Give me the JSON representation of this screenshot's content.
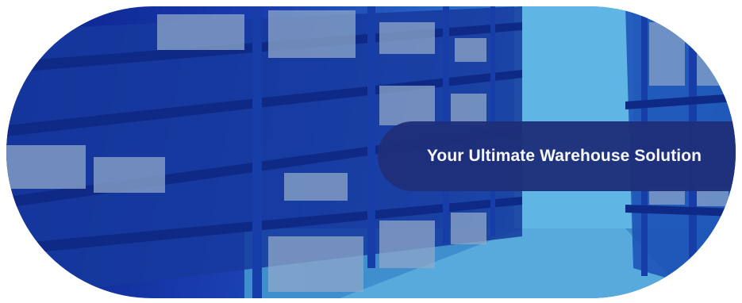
{
  "banner": {
    "headline": "Your Ultimate Warehouse Solution",
    "image": "warehouse-aisle-photo"
  },
  "colors": {
    "overlay_dark": "#0b1f8c",
    "overlay_light": "#46a6db",
    "headline_bg": "#1f2f7a",
    "headline_text": "#ffffff"
  }
}
